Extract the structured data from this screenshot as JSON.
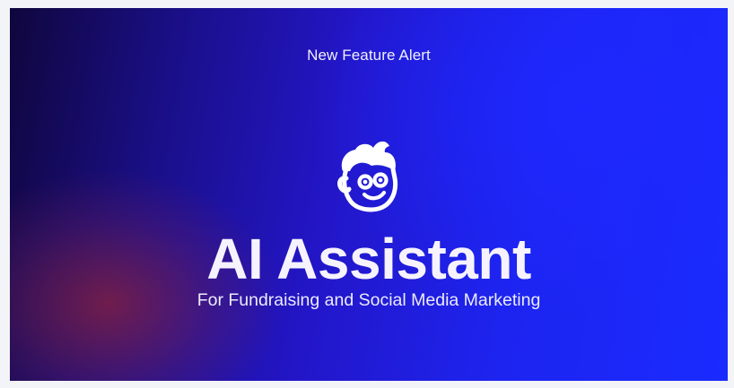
{
  "banner": {
    "eyebrow": "New Feature Alert",
    "headline": "AI Assistant",
    "subheadline": "For Fundraising and Social Media Marketing",
    "mascot_icon": "smiling-boy-face-icon"
  },
  "colors": {
    "background_dark": "#10063d",
    "background_bright": "#1a2bff",
    "glow": "#8c223c",
    "text": "#f6f3ff",
    "page": "#f3f4f7"
  }
}
